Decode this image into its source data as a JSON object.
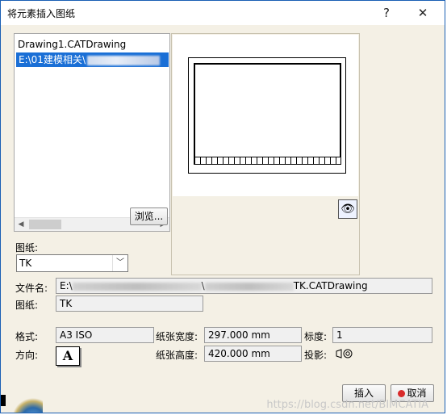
{
  "window": {
    "title": "将元素插入图纸",
    "help": "?",
    "close": "✕"
  },
  "list": {
    "items": [
      {
        "text": "Drawing1.CATDrawing",
        "selected": false
      },
      {
        "text": "E:\\01建模相关\\",
        "selected": true
      }
    ]
  },
  "buttons": {
    "browse": "浏览...",
    "insert": "插入",
    "cancel": "取消"
  },
  "sheet": {
    "label": "图纸:",
    "value": "TK"
  },
  "fields": {
    "filename_label": "文件名:",
    "filename_prefix": "E:\\",
    "filename_mid": "\\",
    "filename_suffix": "TK.CATDrawing",
    "sheet_label": "图纸:",
    "sheet_value": "TK",
    "format_label": "格式:",
    "format_value": "A3 ISO",
    "width_label": "纸张宽度:",
    "width_value": "297.000 mm",
    "scale_label": "标度:",
    "scale_value": "1",
    "orientation_label": "方向:",
    "orientation_glyph": "A",
    "height_label": "纸张高度:",
    "height_value": "420.000 mm",
    "projection_label": "投影:"
  },
  "watermark": "https://blog.csdn.net/BIMCATIA",
  "icons": {
    "eye": "eye-icon",
    "orientation": "portrait-orientation-icon",
    "projection": "first-angle-projection-icon",
    "cancel": "cancel-red-icon",
    "insert": "insert-icon"
  }
}
